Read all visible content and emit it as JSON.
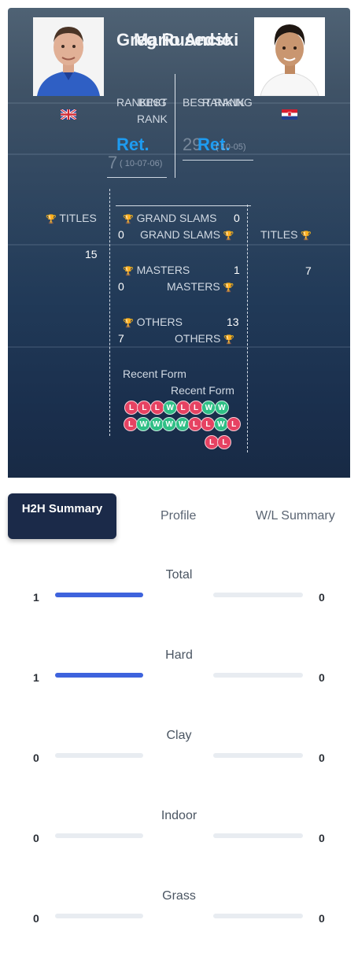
{
  "colors": {
    "accent": "#1e9bf0",
    "bar_fill": "#3e63dd",
    "loss": "#e64262",
    "win": "#2fbf86",
    "active_tab": "#1b2a49"
  },
  "player1": {
    "name": "Greg Rusedski",
    "flag": "gb-flag-icon",
    "rank_label": "RANKING",
    "best_rank_label_1": "BEST",
    "best_rank_label_2": "RANK",
    "current_rank": "Ret.",
    "best_rank": "7",
    "best_rank_date": "( 10-07-06)",
    "titles_label": "TITLES",
    "titles": "15"
  },
  "player2": {
    "name": "Mario Ancic",
    "flag": "hr-flag-icon",
    "rank_label": "RANKING",
    "best_rank_label": "BEST RANK",
    "current_rank": "Ret.",
    "best_rank": "29",
    "best_rank_date": "( 10-05)",
    "titles_label": "TITLES",
    "titles": "7"
  },
  "stats": {
    "grand_slams_label": "GRAND SLAMS",
    "p1_grand_slams": "0",
    "p2_grand_slams": "0",
    "masters_label": "MASTERS",
    "p1_masters": "1",
    "p2_masters": "0",
    "others_label": "OTHERS",
    "p1_others": "13",
    "p2_others": "7"
  },
  "recent_form": {
    "label": "Recent Form",
    "p1": [
      "L",
      "L",
      "L",
      "W",
      "L",
      "L",
      "W",
      "W"
    ],
    "p2_row1": [
      "L",
      "W",
      "W",
      "W",
      "W",
      "L",
      "L",
      "W",
      "L"
    ],
    "p2_row2": [
      "L",
      "L"
    ]
  },
  "tabs": [
    {
      "label": "H2H Summary",
      "active": true
    },
    {
      "label": "Profile",
      "active": false
    },
    {
      "label": "W/L Summary",
      "active": false
    }
  ],
  "h2h": [
    {
      "label": "Total",
      "p1": 1,
      "p2": 0
    },
    {
      "label": "Hard",
      "p1": 1,
      "p2": 0
    },
    {
      "label": "Clay",
      "p1": 0,
      "p2": 0
    },
    {
      "label": "Indoor",
      "p1": 0,
      "p2": 0
    },
    {
      "label": "Grass",
      "p1": 0,
      "p2": 0
    }
  ]
}
